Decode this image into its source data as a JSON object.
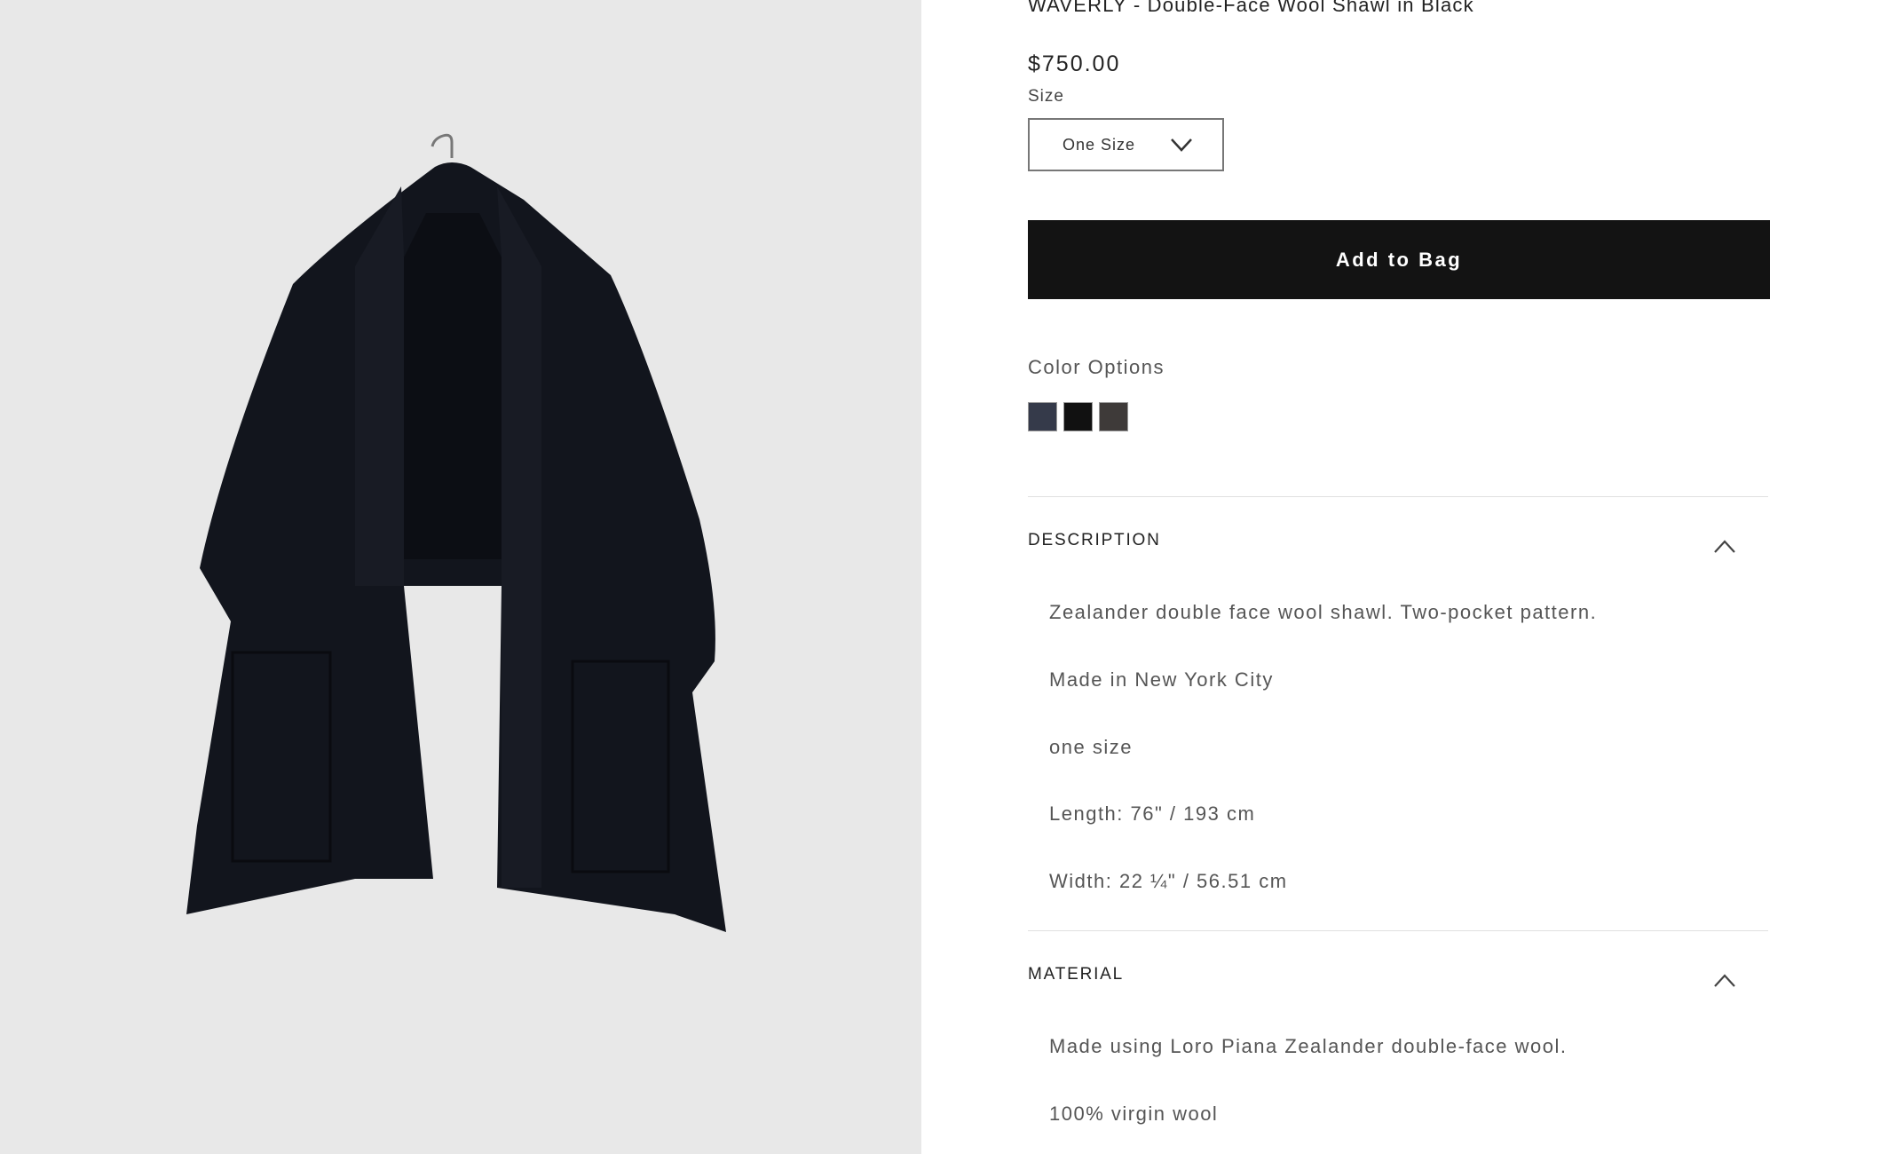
{
  "product": {
    "title": "WAVERLY - Double-Face Wool Shawl in Black",
    "price": "$750.00",
    "image_icon": "shawl-on-hanger"
  },
  "size": {
    "label": "Size",
    "selected": "One Size"
  },
  "cta": {
    "add_to_bag": "Add to Bag"
  },
  "colors": {
    "label": "Color Options",
    "swatches": [
      {
        "name": "navy",
        "hex": "#353a4a"
      },
      {
        "name": "black",
        "hex": "#111111"
      },
      {
        "name": "charcoal",
        "hex": "#3e3a39"
      }
    ]
  },
  "description": {
    "title": "DESCRIPTION",
    "lines": [
      "Zealander double face wool shawl. Two-pocket pattern.",
      "Made in New York City",
      "one size",
      "Length: 76\" / 193 cm",
      "Width: 22 ¼\" / 56.51 cm"
    ]
  },
  "material": {
    "title": "MATERIAL",
    "lines": [
      "Made using Loro Piana Zealander double-face wool.",
      "100% virgin wool"
    ]
  }
}
